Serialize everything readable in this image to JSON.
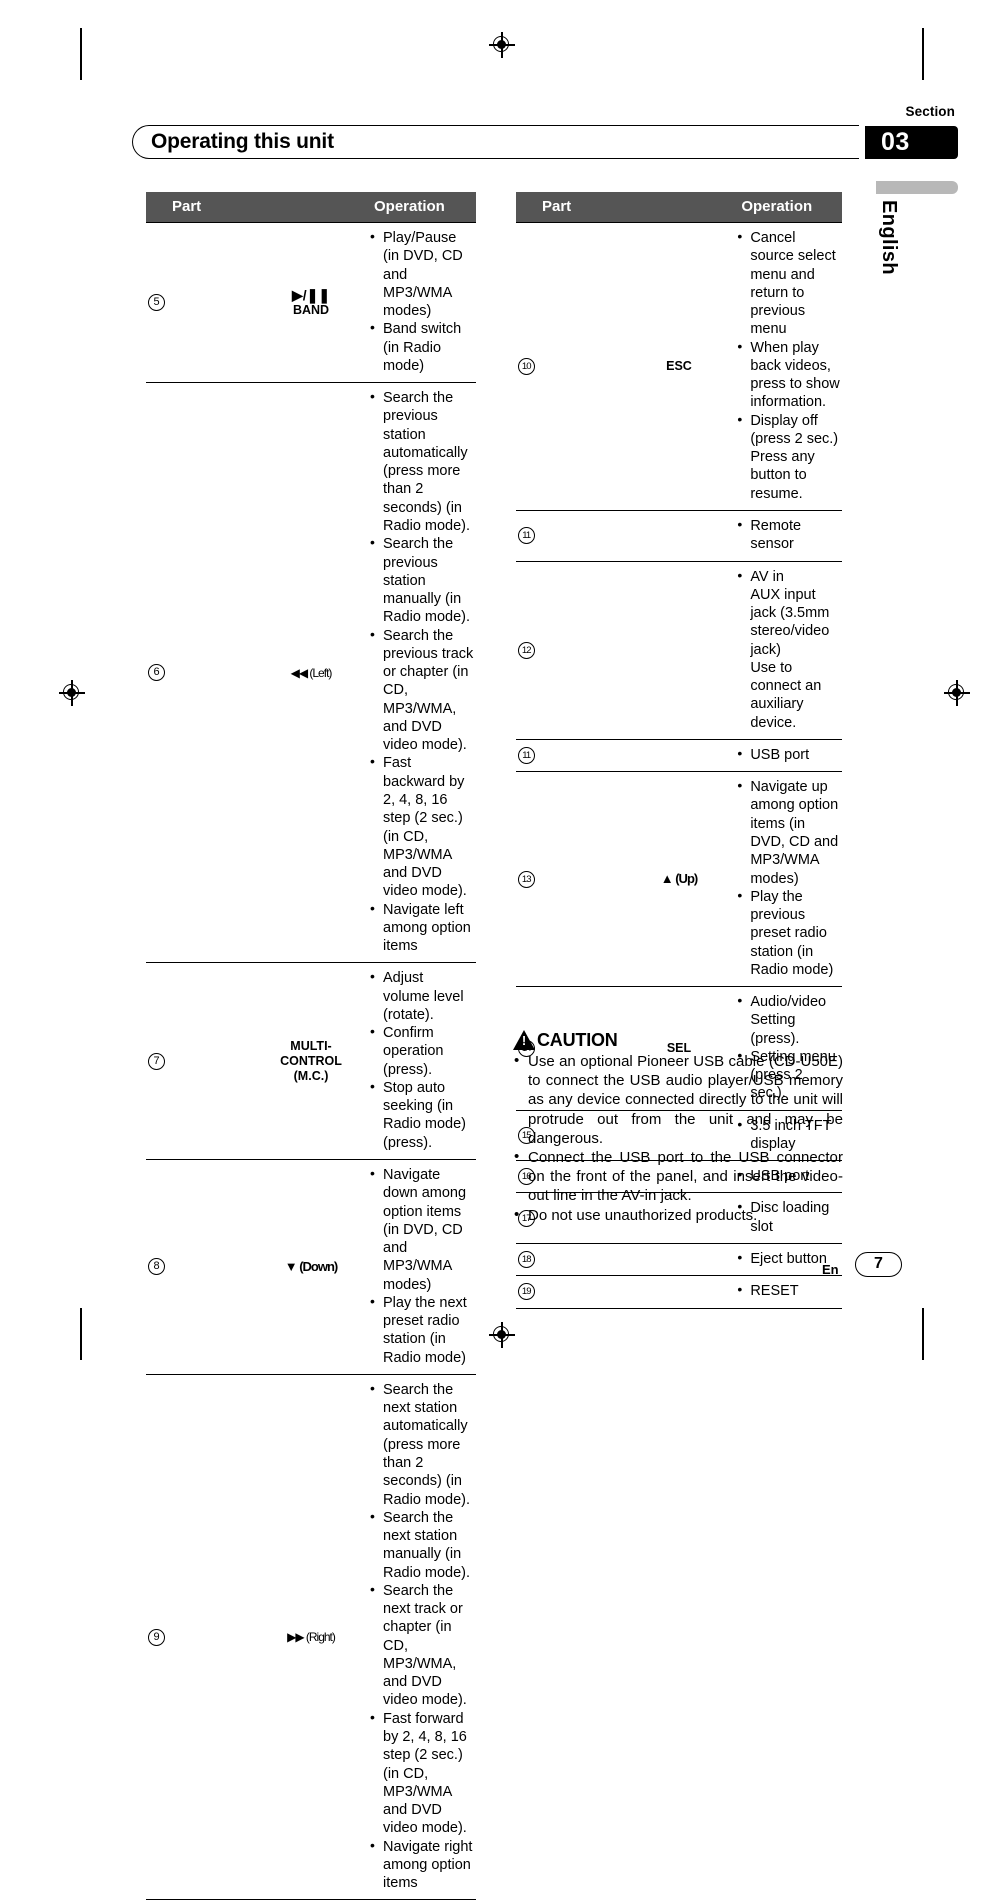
{
  "page": {
    "section_label": "Section",
    "section_number": "03",
    "title": "Operating this unit",
    "language": "English",
    "footer_lang_code": "En",
    "page_number": "7"
  },
  "table_headers": {
    "part": "Part",
    "operation": "Operation"
  },
  "left_table": {
    "rows": [
      {
        "num": "5",
        "part_lines": [
          "▶/❚❚",
          "BAND"
        ],
        "operations": [
          "Play/Pause (in DVD, CD and MP3/WMA modes)",
          "Band switch (in Radio mode)"
        ]
      },
      {
        "num": "6",
        "part_lines": [
          "◀◀ (Left)"
        ],
        "operations": [
          "Search the previous station automatically (press more than 2 seconds) (in Radio mode).",
          "Search the previous station manually (in Radio mode).",
          "Search the previous track or chapter (in CD, MP3/WMA, and DVD video mode).",
          "Fast backward by 2, 4, 8, 16 step (2 sec.) (in CD, MP3/WMA and DVD video mode).",
          "Navigate left among option items"
        ]
      },
      {
        "num": "7",
        "part_lines": [
          "MULTI-",
          "CONTROL",
          "(M.C.)"
        ],
        "operations": [
          "Adjust volume level (rotate).",
          "Confirm operation (press).",
          "Stop auto seeking (in Radio mode) (press)."
        ]
      },
      {
        "num": "8",
        "part_lines": [
          "▼ (Down)"
        ],
        "operations": [
          "Navigate down among option items (in DVD, CD and MP3/WMA modes)",
          "Play the next preset radio station (in Radio mode)"
        ]
      },
      {
        "num": "9",
        "part_lines": [
          "▶▶ (Right)"
        ],
        "operations": [
          "Search the next station automatically (press more than 2 seconds) (in Radio mode).",
          "Search the next station manually (in Radio mode).",
          "Search the next track or chapter (in CD, MP3/WMA, and DVD video mode).",
          "Fast forward by 2, 4, 8, 16 step (2 sec.) (in CD, MP3/WMA and DVD video mode).",
          "Navigate right among option items"
        ]
      }
    ]
  },
  "right_table": {
    "rows": [
      {
        "num": "10",
        "part_lines": [
          "ESC"
        ],
        "operations": [
          "Cancel source select menu and return to previous menu",
          "When play back videos, press to show information.",
          "Display off (press  2 sec.) Press any button to resume."
        ]
      },
      {
        "num": "11",
        "part_lines": [],
        "operations": [
          "Remote sensor"
        ]
      },
      {
        "num": "12",
        "part_lines": [],
        "operations": [
          "AV in\nAUX input jack (3.5mm stereo/video jack)\nUse to connect an auxiliary device."
        ]
      },
      {
        "num": "11",
        "part_lines": [],
        "operations": [
          "USB port"
        ]
      },
      {
        "num": "13",
        "part_lines": [
          "▲ (Up)"
        ],
        "operations": [
          "Navigate up among option items (in DVD, CD and MP3/WMA modes)",
          "Play the previous preset radio station (in Radio mode)"
        ]
      },
      {
        "num": "14",
        "part_lines": [
          "SEL"
        ],
        "operations": [
          "Audio/video Setting (press).",
          "Setting menu (press 2 sec.)."
        ]
      },
      {
        "num": "15",
        "part_lines": [],
        "operations": [
          "3.5 inch TFT display"
        ]
      },
      {
        "num": "16",
        "part_lines": [],
        "operations": [
          "USB port"
        ]
      },
      {
        "num": "17",
        "part_lines": [],
        "operations": [
          " Disc loading slot"
        ]
      },
      {
        "num": "18",
        "part_lines": [],
        "operations": [
          " Eject button"
        ]
      },
      {
        "num": "19",
        "part_lines": [],
        "operations": [
          " RESET"
        ]
      }
    ]
  },
  "caution": {
    "label": "CAUTION",
    "items": [
      "Use an optional Pioneer USB cable (CD-U50E) to connect the USB audio player/USB memory as any device connected directly to the unit will protrude out from the unit and may be dangerous.",
      "Connect the USB port to the USB connector on the front of the panel, and insert the video-out line in the AV-in jack.",
      "Do not use unauthorized products."
    ]
  }
}
